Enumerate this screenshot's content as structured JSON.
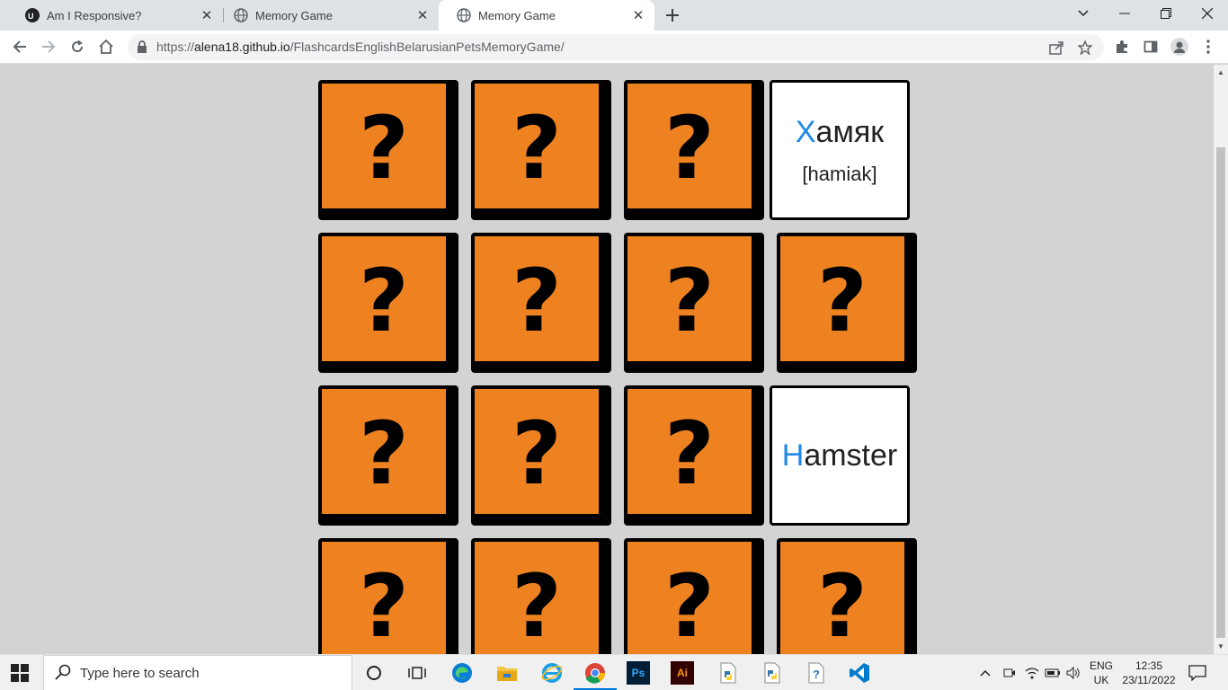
{
  "browser": {
    "tabs": [
      {
        "title": "Am I Responsive?",
        "favicon": "ui-logo-icon",
        "active": false
      },
      {
        "title": "Memory Game",
        "favicon": "globe-icon",
        "active": false
      },
      {
        "title": "Memory Game",
        "favicon": "globe-icon",
        "active": true
      }
    ],
    "url_prefix": "https://",
    "url_host": "alena18.github.io",
    "url_path": "/FlashcardsEnglishBelarusianPetsMemoryGame/"
  },
  "game": {
    "hidden_symbol": "?",
    "open_cards": [
      {
        "first_letter": "Х",
        "rest": "амяк",
        "transcription": "[hamiak]"
      },
      {
        "first_letter": "H",
        "rest": "amster",
        "transcription": ""
      }
    ],
    "card_back_color": "#ef8220",
    "highlight_color": "#1e88e5"
  },
  "taskbar": {
    "search_placeholder": "Type here to search",
    "language_line1": "ENG",
    "language_line2": "UK",
    "time": "12:35",
    "date": "23/11/2022"
  }
}
